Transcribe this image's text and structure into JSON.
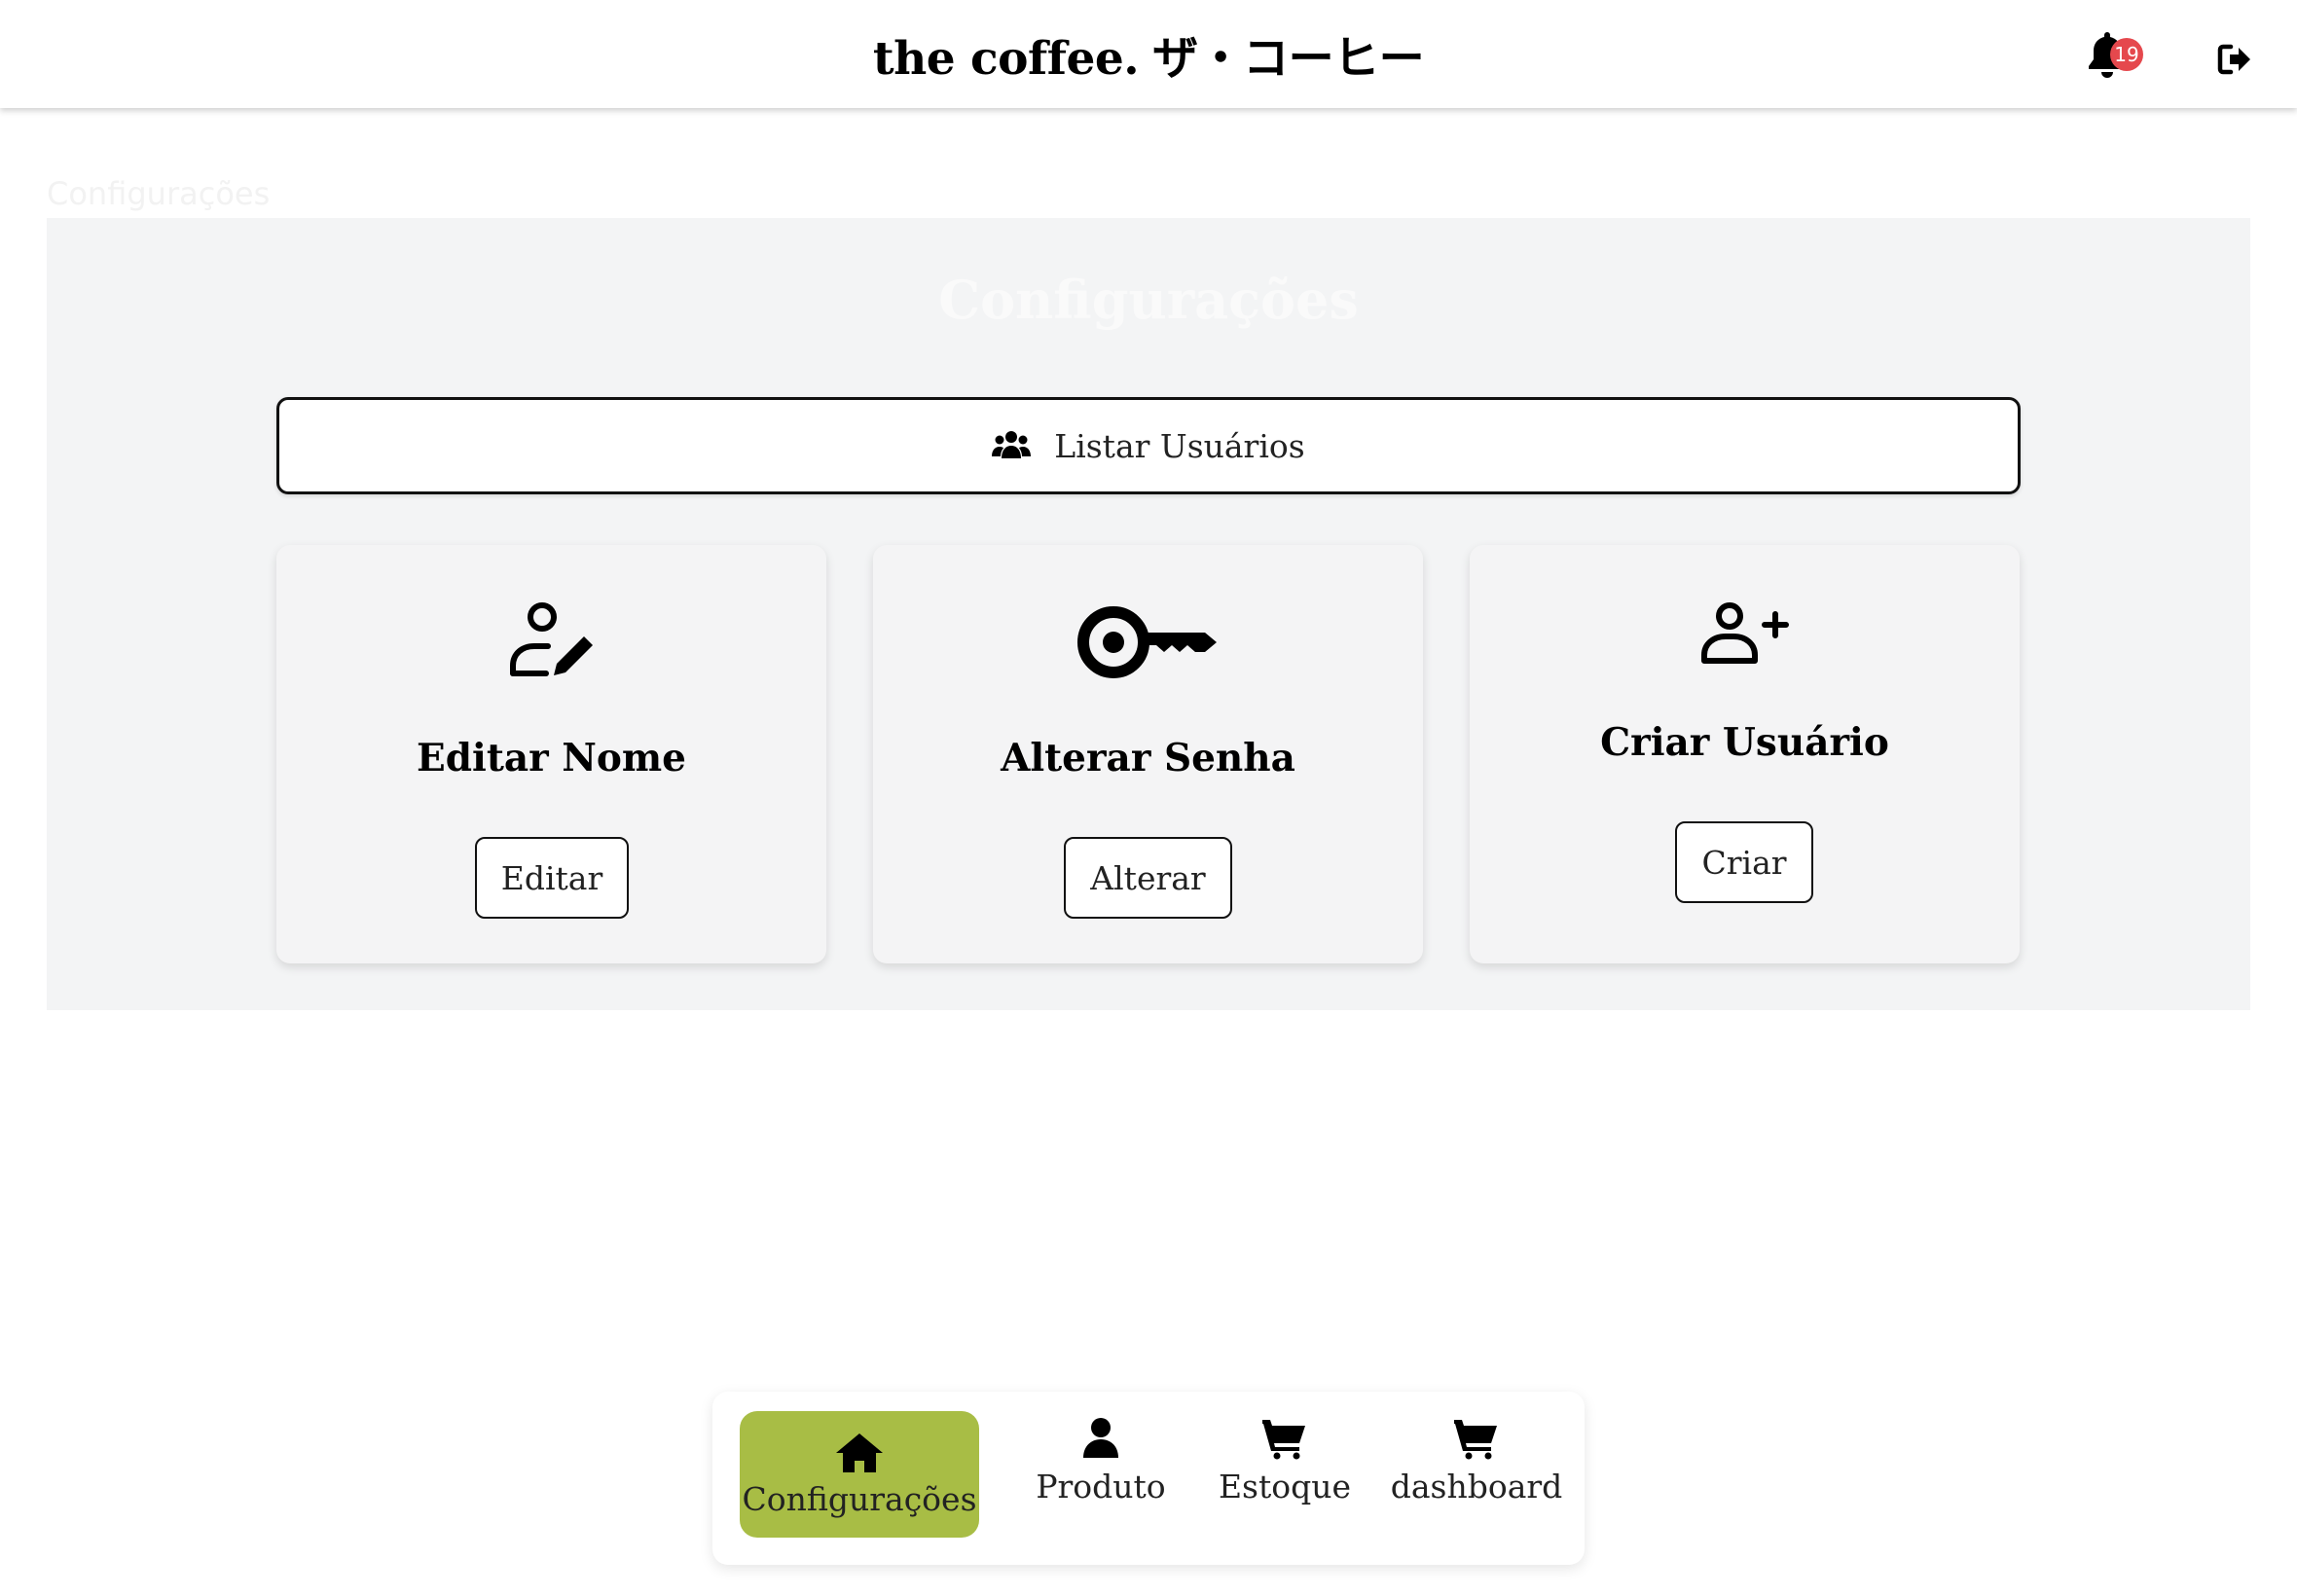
{
  "header": {
    "brand": "the coffee.",
    "brand_jp": "ザ・コーヒー",
    "notification_count": "19",
    "icons": {
      "notifications": "bell-icon",
      "logout": "logout-icon"
    }
  },
  "page": {
    "title": "Configurações",
    "panel_heading": "Configurações"
  },
  "actions": {
    "list_users_label": "Listar Usuários",
    "cards": [
      {
        "title": "Editar Nome",
        "button": "Editar",
        "icon": "user-edit-icon"
      },
      {
        "title": "Alterar Senha",
        "button": "Alterar",
        "icon": "key-icon"
      },
      {
        "title": "Criar Usuário",
        "button": "Criar",
        "icon": "user-plus-icon"
      }
    ]
  },
  "nav": {
    "items": [
      {
        "label": "Configurações",
        "icon": "home-icon",
        "active": true
      },
      {
        "label": "Produto",
        "icon": "user-icon",
        "active": false
      },
      {
        "label": "Estoque",
        "icon": "cart-icon",
        "active": false
      },
      {
        "label": "dashboard",
        "icon": "cart-icon",
        "active": false
      }
    ]
  },
  "colors": {
    "accent": "#a8bd45",
    "badge": "#e5484d",
    "panel_bg": "#f3f4f5"
  }
}
